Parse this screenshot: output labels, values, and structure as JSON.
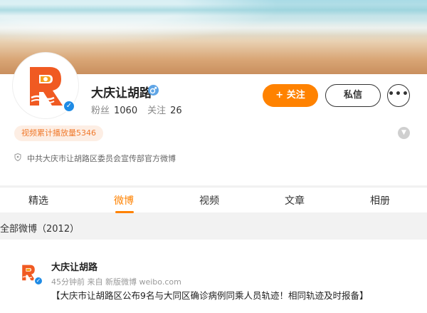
{
  "profile": {
    "name": "大庆让胡路",
    "fans_label": "粉丝",
    "fans_count": "1060",
    "following_label": "关注",
    "following_count": "26",
    "follow_button": "+ 关注",
    "message_button": "私信",
    "more_button": "•••",
    "play_count_pill": "视频累计播放量5346",
    "description": "中共大庆市让胡路区委员会宣传部官方微博"
  },
  "tabs": [
    {
      "label": "精选"
    },
    {
      "label": "微博"
    },
    {
      "label": "视频"
    },
    {
      "label": "文章"
    },
    {
      "label": "相册"
    }
  ],
  "active_tab": "微博",
  "section": {
    "title": "全部微博（2012）"
  },
  "post": {
    "author": "大庆让胡路",
    "meta": "45分钟前 来自 新版微博 weibo.com",
    "text": "【大庆市让胡路区公布9名与大同区确诊病例同乘人员轨迹！相同轨迹及时报备】"
  },
  "colors": {
    "accent": "#ff8200",
    "verified": "#1f8be5",
    "logo_orange": "#f05a22"
  },
  "icons": {
    "verified": "verified-icon",
    "expand": "chevron-down-icon",
    "description": "shield-icon"
  }
}
